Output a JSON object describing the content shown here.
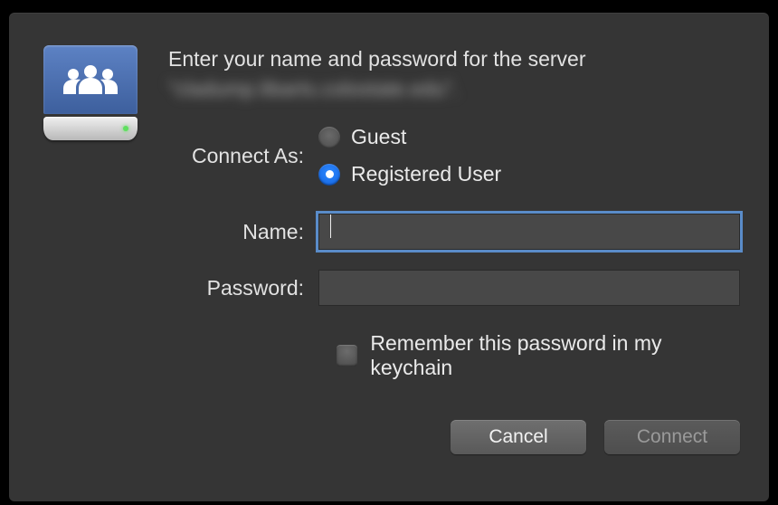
{
  "dialog": {
    "prompt": "Enter your name and password for the server",
    "server_display": "\"cladump.libarts.colostate.edu\".",
    "connect_as_label": "Connect As:",
    "options": {
      "guest": {
        "label": "Guest",
        "selected": false
      },
      "registered": {
        "label": "Registered User",
        "selected": true
      }
    },
    "fields": {
      "name_label": "Name:",
      "name_value": "",
      "password_label": "Password:",
      "password_value": ""
    },
    "remember": {
      "label": "Remember this password in my keychain",
      "checked": false
    },
    "buttons": {
      "cancel": "Cancel",
      "connect": "Connect",
      "connect_enabled": false
    }
  }
}
